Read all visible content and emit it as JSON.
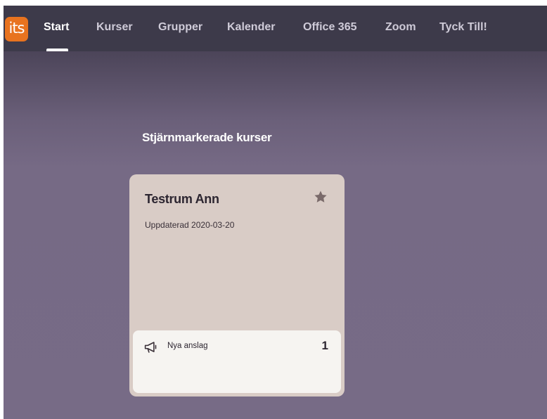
{
  "app": {
    "logo_text": "its",
    "logo_color": "#e8731f"
  },
  "nav": {
    "items": [
      {
        "label": "Start",
        "active": true
      },
      {
        "label": "Kurser"
      },
      {
        "label": "Grupper"
      },
      {
        "label": "Kalender"
      },
      {
        "label": "Office 365"
      },
      {
        "label": "Zoom"
      },
      {
        "label": "Tyck Till!"
      }
    ]
  },
  "main": {
    "section_title": "Stjärnmarkerade kurser",
    "courses": [
      {
        "title": "Testrum Ann",
        "updated": "Uppdaterad 2020-03-20",
        "starred": true,
        "icon": "star-icon",
        "notification": {
          "icon": "megaphone-icon",
          "label": "Nya anslag",
          "count": "1"
        }
      }
    ]
  },
  "colors": {
    "topbar": "#3d3a4a",
    "background": "#776b86",
    "card": "#d9ccc6",
    "card_footer": "#f6f4f1",
    "star": "#7a6a6a"
  }
}
